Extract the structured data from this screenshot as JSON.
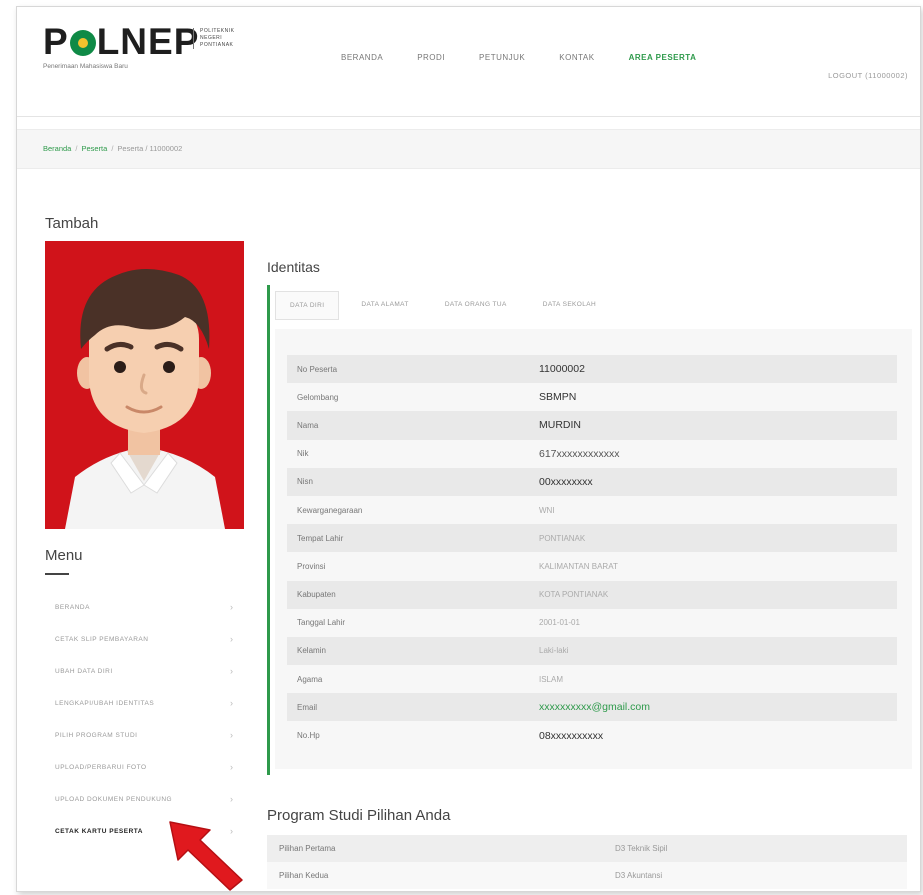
{
  "header": {
    "logo_text_1": "P",
    "logo_text_2": "LNEP",
    "logo_side": [
      "POLITEKNIK",
      "NEGERI",
      "PONTIANAK"
    ],
    "logo_tagline": "Penerimaan Mahasiswa Baru",
    "nav": [
      "BERANDA",
      "PRODI",
      "PETUNJUK",
      "KONTAK",
      "AREA PESERTA"
    ],
    "nav_active": "AREA PESERTA",
    "logout": "LOGOUT (11000002)"
  },
  "breadcrumb": {
    "items": [
      "Beranda",
      "Peserta"
    ],
    "current": "Peserta / 11000002",
    "separator": "/"
  },
  "page": {
    "heading": "Tambah",
    "menu_title": "Menu"
  },
  "menu": {
    "items": [
      {
        "label": "BERANDA"
      },
      {
        "label": "CETAK SLIP PEMBAYARAN"
      },
      {
        "label": "UBAH DATA DIRI"
      },
      {
        "label": "LENGKAPI/UBAH IDENTITAS"
      },
      {
        "label": "PILIH PROGRAM STUDI"
      },
      {
        "label": "UPLOAD/PERBARUI FOTO"
      },
      {
        "label": "UPLOAD DOKUMEN PENDUKUNG"
      },
      {
        "label": "CETAK KARTU PESERTA"
      }
    ],
    "active": "CETAK KARTU PESERTA",
    "chevron": "›"
  },
  "identitas": {
    "title": "Identitas",
    "tabs": [
      "DATA DIRI",
      "DATA ALAMAT",
      "DATA ORANG TUA",
      "DATA SEKOLAH"
    ],
    "active_tab": "DATA DIRI",
    "rows": [
      {
        "key": "No Peserta",
        "value": "11000002"
      },
      {
        "key": "Gelombang",
        "value": "SBMPN"
      },
      {
        "key": "Nama",
        "value": "MURDIN"
      },
      {
        "key": "Nik",
        "value": "617xxxxxxxxxxxx"
      },
      {
        "key": "Nisn",
        "value": "00xxxxxxxx"
      },
      {
        "key": "Kewarganegaraan",
        "value": "WNI"
      },
      {
        "key": "Tempat Lahir",
        "value": "PONTIANAK"
      },
      {
        "key": "Provinsi",
        "value": "KALIMANTAN BARAT"
      },
      {
        "key": "Kabupaten",
        "value": "KOTA PONTIANAK"
      },
      {
        "key": "Tanggal Lahir",
        "value": "2001-01-01"
      },
      {
        "key": "Kelamin",
        "value": "Laki-laki"
      },
      {
        "key": "Agama",
        "value": "ISLAM"
      },
      {
        "key": "Email",
        "value": "xxxxxxxxxx@gmail.com"
      },
      {
        "key": "No.Hp",
        "value": "08xxxxxxxxxx"
      }
    ]
  },
  "prodi": {
    "title": "Program Studi Pilihan Anda",
    "rows": [
      {
        "key": "Pilihan Pertama",
        "value": "D3 Teknik Sipil"
      },
      {
        "key": "Pilihan Kedua",
        "value": "D3 Akuntansi"
      }
    ]
  },
  "colors": {
    "accent_green": "#2e9a4b",
    "avatar_bg": "#d0131a",
    "arrow": "#e0191e"
  },
  "icons": {
    "avatar": "person-avatar-icon",
    "pointer": "red-arrow-icon"
  }
}
